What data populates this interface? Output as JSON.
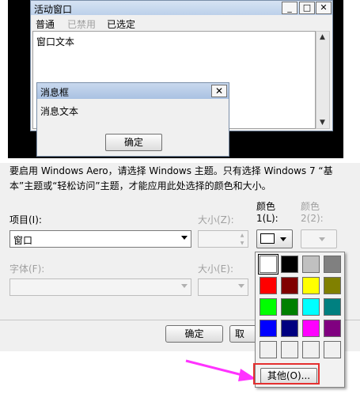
{
  "preview": {
    "active_window_title": "活动窗口",
    "window_buttons": [
      "_",
      "□",
      "✕"
    ],
    "menu": [
      {
        "label": "普通",
        "disabled": false
      },
      {
        "label": "已禁用",
        "disabled": true
      },
      {
        "label": "已选定",
        "disabled": false
      }
    ],
    "window_text": "窗口文本",
    "message_box": {
      "title": "消息框",
      "close": "✕",
      "text": "消息文本",
      "ok_button": "确定"
    }
  },
  "info_text": "要启用 Windows Aero，请选择 Windows 主题。只有选择 Windows 7 “基本”主题或“轻松访问”主题，才能应用此处选择的颜色和大小。",
  "item": {
    "label": "项目(I):",
    "value": "窗口",
    "size_label": "大小(Z):",
    "color1_label_a": "颜色",
    "color1_label_b": "1(L):",
    "color2_label_a": "颜色",
    "color2_label_b": "2(2):"
  },
  "font": {
    "label": "字体(F):",
    "size_label": "大小(E):"
  },
  "palette": {
    "colors": [
      "#ffffff",
      "#000000",
      "#c0c0c0",
      "#808080",
      "#ff0000",
      "#800000",
      "#ffff00",
      "#808000",
      "#00ff00",
      "#008000",
      "#00ffff",
      "#008080",
      "#0000ff",
      "#000080",
      "#ff00ff",
      "#800080",
      "#f0f0f0",
      "#f0f0f0",
      "#f0f0f0",
      "#f0f0f0"
    ],
    "selected_color": "#ffffff",
    "other_button": "其他(O)..."
  },
  "dialog_buttons": {
    "ok": "确定",
    "cancel_partial": "取"
  },
  "annotation": {
    "arrow_color": "#ff33ff",
    "highlight_color": "#e53030"
  }
}
